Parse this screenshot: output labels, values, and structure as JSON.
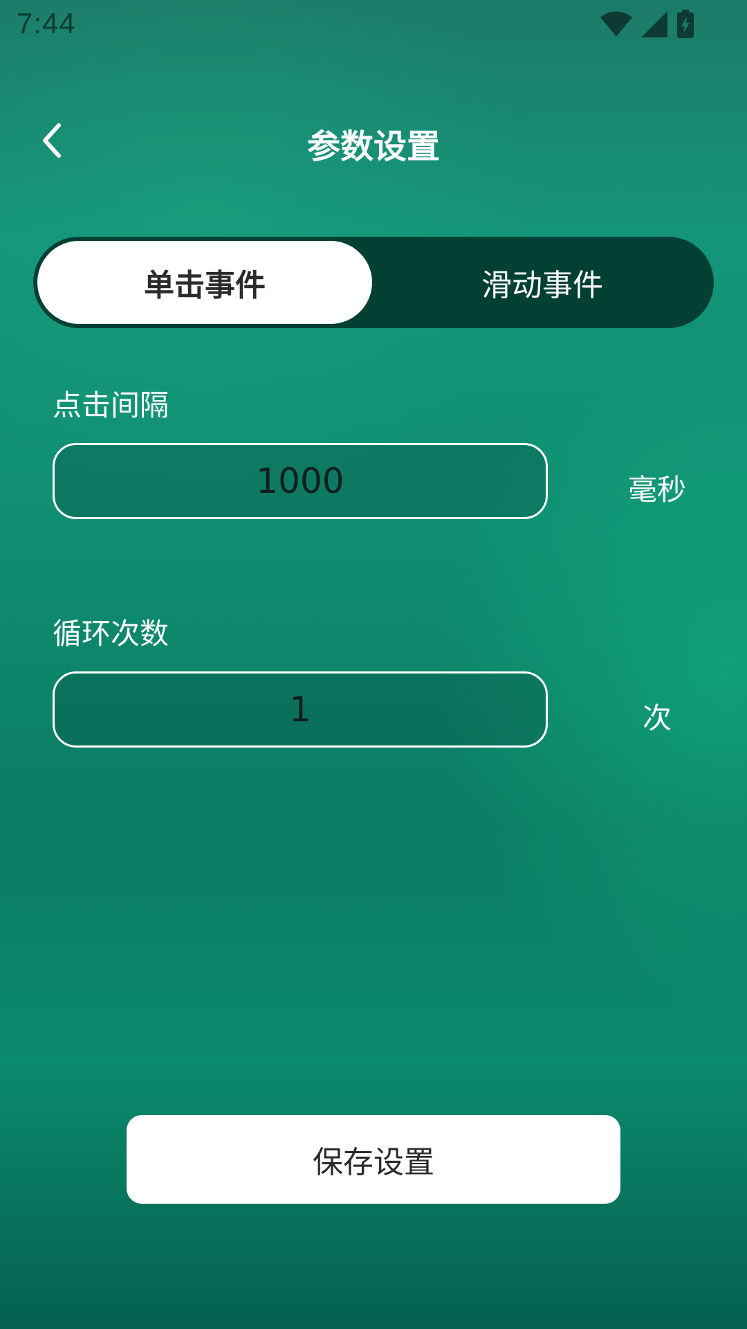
{
  "status_bar": {
    "time": "7:44",
    "icons": [
      "wifi-icon",
      "cellular-signal-icon",
      "battery-charging-icon"
    ]
  },
  "header": {
    "title": "参数设置",
    "back_icon": "chevron-left-icon"
  },
  "tabs": {
    "items": [
      {
        "label": "单击事件",
        "selected": true
      },
      {
        "label": "滑动事件",
        "selected": false
      }
    ]
  },
  "fields": {
    "click_interval": {
      "label": "点击间隔",
      "value": "1000",
      "unit": "毫秒"
    },
    "loop_count": {
      "label": "循环次数",
      "value": "1",
      "unit": "次"
    }
  },
  "actions": {
    "save_label": "保存设置"
  },
  "colors": {
    "segment_bg": "#024034",
    "active_tab_bg": "#ffffff",
    "accent_green": "#0f8e72"
  }
}
